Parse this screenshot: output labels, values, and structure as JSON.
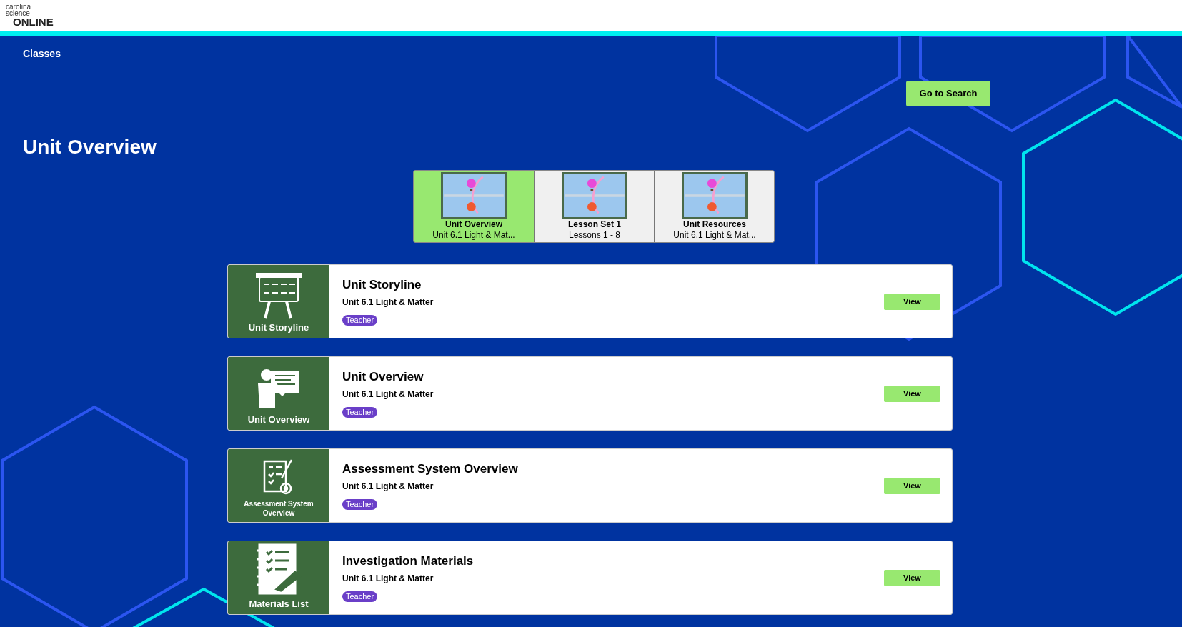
{
  "logo": {
    "line_1": "carolina",
    "line_2": "science",
    "line_3": "ONLINE"
  },
  "breadcrumb": "Classes",
  "search_button": "Go to Search",
  "page_title": "Unit Overview",
  "tabs": [
    {
      "title": "Unit Overview",
      "subtitle": "Unit 6.1 Light & Mat...",
      "selected": true
    },
    {
      "title": "Lesson Set 1",
      "subtitle": "Lessons 1 - 8",
      "selected": false
    },
    {
      "title": "Unit Resources",
      "subtitle": "Unit 6.1 Light & Mat...",
      "selected": false
    }
  ],
  "cards": [
    {
      "kind": "storyline",
      "tile_label": "Unit Storyline",
      "title": "Unit Storyline",
      "subtitle": "Unit 6.1 Light & Matter",
      "tag": "Teacher",
      "button": "View"
    },
    {
      "kind": "overview",
      "tile_label": "Unit Overview",
      "title": "Unit Overview",
      "subtitle": "Unit 6.1 Light & Matter",
      "tag": "Teacher",
      "button": "View"
    },
    {
      "kind": "assessment",
      "tile_label": "Assessment System Overview",
      "title": "Assessment System Overview",
      "subtitle": "Unit 6.1 Light & Matter",
      "tag": "Teacher",
      "button": "View"
    },
    {
      "kind": "materials",
      "tile_label": "Materials List",
      "title": "Investigation Materials",
      "subtitle": "Unit 6.1 Light & Matter",
      "tag": "Teacher",
      "button": "View"
    }
  ]
}
